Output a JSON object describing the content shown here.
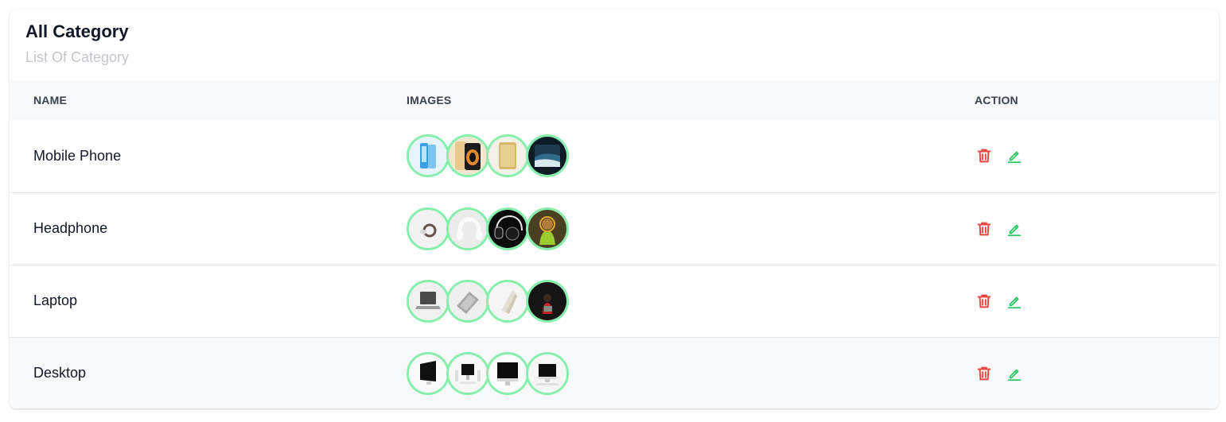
{
  "header": {
    "title": "All Category",
    "subtitle": "List Of Category"
  },
  "table": {
    "columns": [
      "NAME",
      "IMAGES",
      "ACTION"
    ],
    "rows": [
      {
        "name": "Mobile Phone",
        "images": [
          "phone-blue",
          "phone-gold-dark",
          "phone-gold",
          "phone-ocean"
        ]
      },
      {
        "name": "Headphone",
        "images": [
          "earbuds-white",
          "headphones-white",
          "headphones-black",
          "headphones-person"
        ]
      },
      {
        "name": "Laptop",
        "images": [
          "laptop-open-gray",
          "laptop-angle-gray",
          "laptop-folded-white",
          "laptop-person-dark"
        ]
      },
      {
        "name": "Desktop",
        "images": [
          "desktop-monitor",
          "desktop-setup",
          "desktop-imac",
          "desktop-imac-setup"
        ]
      }
    ]
  },
  "colors": {
    "accent_border": "#86efac",
    "delete": "#ef4444",
    "edit": "#22c55e",
    "header_bg": "#f8f9fa"
  },
  "icons": {
    "delete": "trash-icon",
    "edit": "pencil-icon"
  }
}
